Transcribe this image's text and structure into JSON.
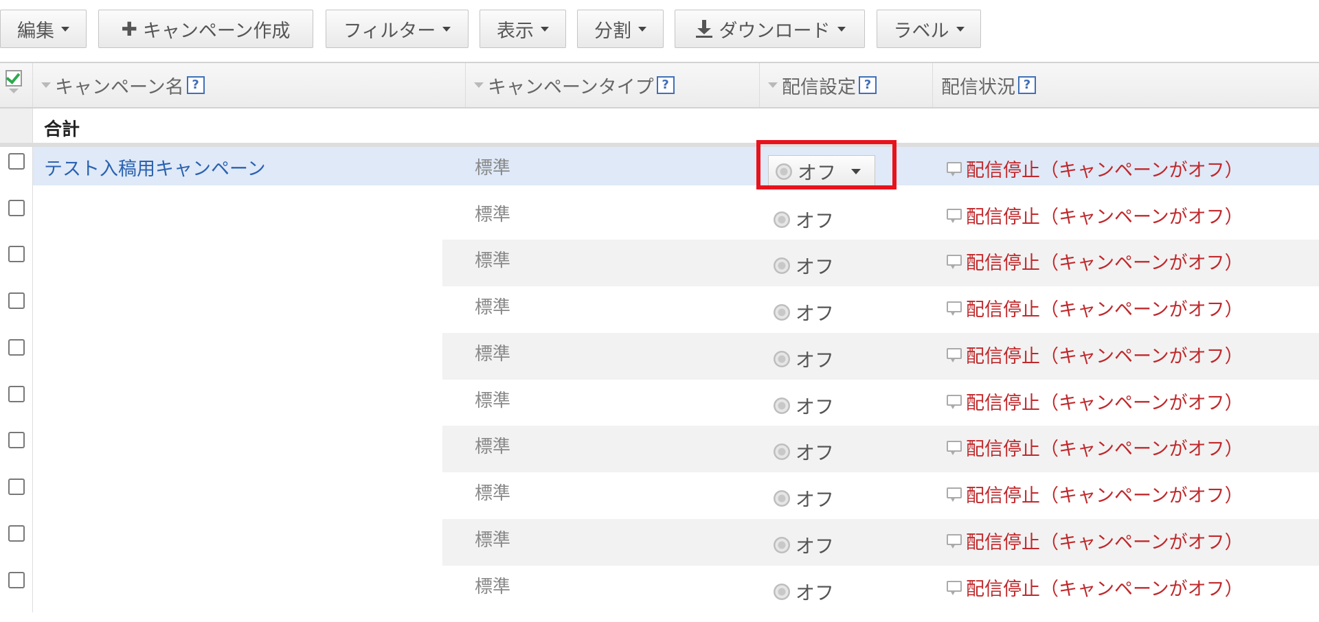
{
  "toolbar": {
    "edit": "編集",
    "create_campaign": "キャンペーン作成",
    "filter": "フィルター",
    "view": "表示",
    "segment": "分割",
    "download": "ダウンロード",
    "label": "ラベル"
  },
  "table": {
    "columns": {
      "campaign_name": "キャンペーン名",
      "campaign_type": "キャンペーンタイプ",
      "delivery_setting": "配信設定",
      "delivery_status": "配信状況"
    },
    "help_icon_text": "?",
    "total_label": "合計",
    "rows": [
      {
        "name": "テスト入稿用キャンペーン",
        "type": "標準",
        "setting": "オフ",
        "status": "配信停止（キャンペーンがオフ）",
        "selected": true
      },
      {
        "name": "",
        "type": "標準",
        "setting": "オフ",
        "status": "配信停止（キャンペーンがオフ）"
      },
      {
        "name": "",
        "type": "標準",
        "setting": "オフ",
        "status": "配信停止（キャンペーンがオフ）"
      },
      {
        "name": "",
        "type": "標準",
        "setting": "オフ",
        "status": "配信停止（キャンペーンがオフ）"
      },
      {
        "name": "",
        "type": "標準",
        "setting": "オフ",
        "status": "配信停止（キャンペーンがオフ）"
      },
      {
        "name": "",
        "type": "標準",
        "setting": "オフ",
        "status": "配信停止（キャンペーンがオフ）"
      },
      {
        "name": "",
        "type": "標準",
        "setting": "オフ",
        "status": "配信停止（キャンペーンがオフ）"
      },
      {
        "name": "",
        "type": "標準",
        "setting": "オフ",
        "status": "配信停止（キャンペーンがオフ）"
      },
      {
        "name": "",
        "type": "標準",
        "setting": "オフ",
        "status": "配信停止（キャンペーンがオフ）"
      },
      {
        "name": "",
        "type": "標準",
        "setting": "オフ",
        "status": "配信停止（キャンペーンがオフ）"
      }
    ]
  },
  "colors": {
    "link": "#2b62b0",
    "status_red": "#c0282b",
    "highlight_red": "#e8121c",
    "selected_row": "#dfe9f7",
    "alt_row": "#f2f2f2"
  },
  "icons": {
    "plus": "plus-icon",
    "download": "download-icon",
    "caret": "caret-down-icon",
    "help": "help-icon",
    "checkbox": "checkbox-icon",
    "radio": "radio-off-icon",
    "speech": "speech-bubble-icon"
  }
}
